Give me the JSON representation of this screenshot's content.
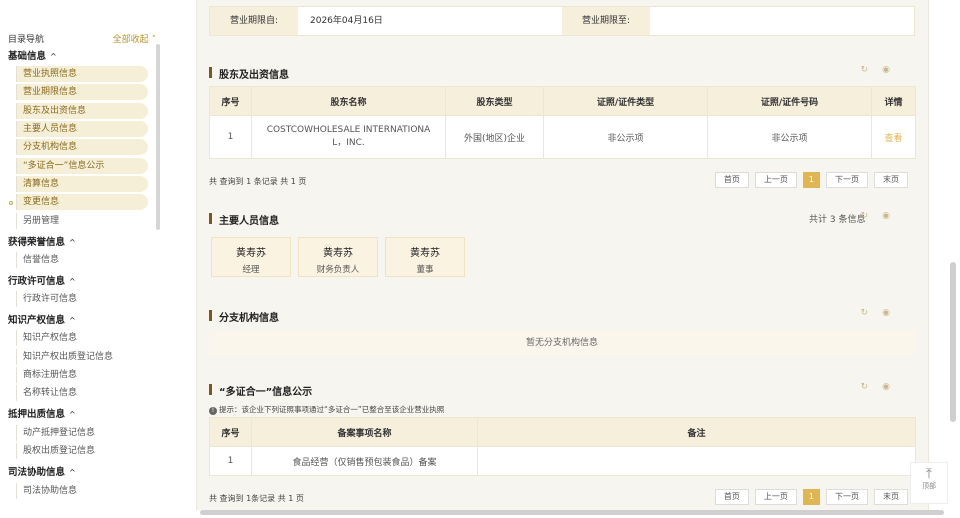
{
  "sidebar": {
    "title": "目录导航",
    "collapse_all": "全部收起 ˄",
    "groups": [
      {
        "label": "基础信息",
        "items": [
          "营业执照信息",
          "营业期限信息",
          "股东及出资信息",
          "主要人员信息",
          "分支机构信息",
          "“多证合一”信息公示",
          "清算信息",
          "变更信息",
          "另册管理"
        ]
      },
      {
        "label": "获得荣誉信息",
        "items": [
          "信誉信息"
        ]
      },
      {
        "label": "行政许可信息",
        "items": [
          "行政许可信息"
        ]
      },
      {
        "label": "知识产权信息",
        "items": [
          "知识产权信息",
          "知识产权出质登记信息",
          "商标注册信息",
          "名称转让信息"
        ]
      },
      {
        "label": "抵押出质信息",
        "items": [
          "动产抵押登记信息",
          "股权出质登记信息"
        ]
      },
      {
        "label": "司法协助信息",
        "items": [
          "司法协助信息"
        ]
      }
    ],
    "caret": "^"
  },
  "term": {
    "from_label": "营业期限自:",
    "from_value": "2026年04月16日",
    "to_label": "营业期限至:",
    "to_value": ""
  },
  "shareholders": {
    "title": "股东及出资信息",
    "headers": [
      "序号",
      "股东名称",
      "股东类型",
      "证照/证件类型",
      "证照/证件号码",
      "详情"
    ],
    "row": {
      "no": "1",
      "name": "COSTCOWHOLESALE INTERNATIONAL，INC.",
      "type": "外国(地区)企业",
      "id_type": "非公示项",
      "id_no": "非公示项",
      "detail": "查看"
    },
    "pager_info": "共 查询到 1 条记录 共 1 页"
  },
  "pager": {
    "first": "首页",
    "prev": "上一页",
    "current": "1",
    "next": "下一页",
    "last": "末页"
  },
  "personnel": {
    "title": "主要人员信息",
    "count": "共计 3 条信息",
    "people": [
      {
        "name": "黄寿苏",
        "role": "经理"
      },
      {
        "name": "黄寿苏",
        "role": "财务负责人"
      },
      {
        "name": "黄寿苏",
        "role": "董事"
      }
    ]
  },
  "branches": {
    "title": "分支机构信息",
    "empty": "暂无分支机构信息"
  },
  "multi_cert": {
    "title": "“多证合一”信息公示",
    "hint": "提示：该企业下列证照事项通过“多证合一”已整合至该企业营业执照",
    "headers": [
      "序号",
      "备案事项名称",
      "备注"
    ],
    "row": {
      "no": "1",
      "name": "食品经营（仅销售预包装食品）备案",
      "note": ""
    },
    "pager_info": "共 查询到 1条记录 共 1 页"
  },
  "icons": {
    "refresh": "↻",
    "eye": "◉"
  },
  "to_top": "顶部"
}
